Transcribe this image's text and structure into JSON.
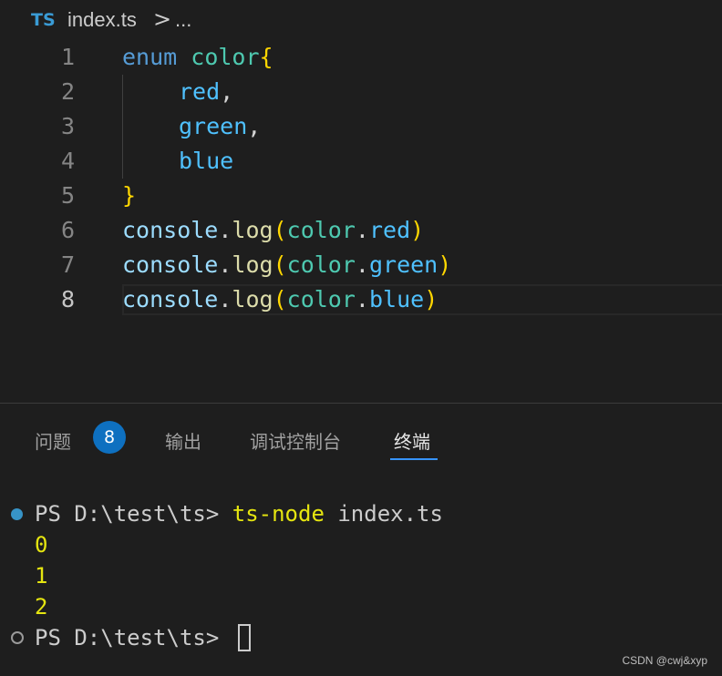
{
  "breadcrumb": {
    "file_icon": "TS",
    "file_name": "index.ts",
    "separator": ">",
    "ellipsis": "..."
  },
  "editor": {
    "active_line": 8,
    "lines": [
      {
        "number": "1",
        "tokens": [
          "enum",
          " ",
          "color",
          "{"
        ]
      },
      {
        "number": "2",
        "tokens": [
          "red",
          ","
        ]
      },
      {
        "number": "3",
        "tokens": [
          "green",
          ","
        ]
      },
      {
        "number": "4",
        "tokens": [
          "blue"
        ]
      },
      {
        "number": "5",
        "tokens": [
          "}"
        ]
      },
      {
        "number": "6",
        "tokens": [
          "console",
          ".",
          "log",
          "(",
          "color",
          ".",
          "red",
          ")"
        ]
      },
      {
        "number": "7",
        "tokens": [
          "console",
          ".",
          "log",
          "(",
          "color",
          ".",
          "green",
          ")"
        ]
      },
      {
        "number": "8",
        "tokens": [
          "console",
          ".",
          "log",
          "(",
          "color",
          ".",
          "blue",
          ")"
        ]
      }
    ]
  },
  "panel": {
    "tabs": [
      {
        "label": "问题",
        "badge": "8"
      },
      {
        "label": "输出"
      },
      {
        "label": "调试控制台"
      },
      {
        "label": "终端",
        "active": true
      }
    ]
  },
  "terminal": {
    "prompt": "PS D:\\test\\ts>",
    "command": "ts-node",
    "argument": "index.ts",
    "output": [
      "0",
      "1",
      "2"
    ],
    "final_prompt": "PS D:\\test\\ts>"
  },
  "watermark": "CSDN @cwj&xyp",
  "colors": {
    "background": "#1e1e1e",
    "keyword": "#569cd6",
    "type": "#4ec9b0",
    "bracket": "#ffd700",
    "property": "#4fc1ff",
    "function": "#dcdcaa",
    "terminal_output": "#e5e510",
    "tab_accent": "#3794ff",
    "badge": "#0e70c0"
  }
}
